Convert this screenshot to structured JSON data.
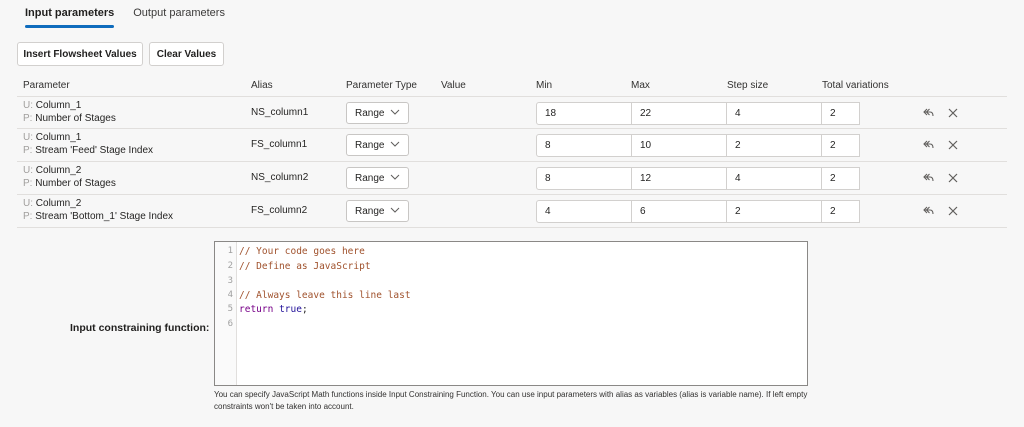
{
  "tabs": [
    {
      "label": "Input parameters",
      "active": true
    },
    {
      "label": "Output parameters",
      "active": false
    }
  ],
  "toolbar": {
    "insert_label": "Insert Flowsheet Values",
    "clear_label": "Clear Values"
  },
  "table": {
    "headers": {
      "parameter": "Parameter",
      "alias": "Alias",
      "type": "Parameter Type",
      "value": "Value",
      "min": "Min",
      "max": "Max",
      "step": "Step size",
      "total": "Total variations"
    },
    "rows": [
      {
        "u_prefix": "U:",
        "unit": "Column_1",
        "p_prefix": "P:",
        "param": "Number of Stages",
        "alias": "NS_column1",
        "type": "Range",
        "min": "18",
        "max": "22",
        "step": "4",
        "total": "2"
      },
      {
        "u_prefix": "U:",
        "unit": "Column_1",
        "p_prefix": "P:",
        "param": "Stream 'Feed' Stage Index",
        "alias": "FS_column1",
        "type": "Range",
        "min": "8",
        "max": "10",
        "step": "2",
        "total": "2"
      },
      {
        "u_prefix": "U:",
        "unit": "Column_2",
        "p_prefix": "P:",
        "param": "Number of Stages",
        "alias": "NS_column2",
        "type": "Range",
        "min": "8",
        "max": "12",
        "step": "4",
        "total": "2"
      },
      {
        "u_prefix": "U:",
        "unit": "Column_2",
        "p_prefix": "P:",
        "param": "Stream 'Bottom_1' Stage Index",
        "alias": "FS_column2",
        "type": "Range",
        "min": "4",
        "max": "6",
        "step": "2",
        "total": "2"
      }
    ]
  },
  "constraint": {
    "label": "Input constraining function:",
    "code_lines": [
      {
        "num": "1",
        "text": "// Your code goes here"
      },
      {
        "num": "2",
        "text": "// Define as JavaScript"
      },
      {
        "num": "3",
        "text": ""
      },
      {
        "num": "4",
        "text": "// Always leave this line last"
      },
      {
        "num": "5",
        "kw": "return",
        "atom": "true",
        "end": ";"
      },
      {
        "num": "6",
        "text": ""
      }
    ],
    "hint": "You can specify JavaScript Math functions inside Input Constraining Function. You can use input parameters with alias as variables (alias is variable name). If left empty constraints won't be taken into account."
  },
  "icons": {
    "reset": "undo-arrow-icon",
    "delete": "close-icon",
    "dropdown": "chevron-down-icon"
  },
  "colors": {
    "accent": "#0f6cbd",
    "comment": "#a0522d",
    "keyword": "#770088",
    "atom": "#221199"
  }
}
